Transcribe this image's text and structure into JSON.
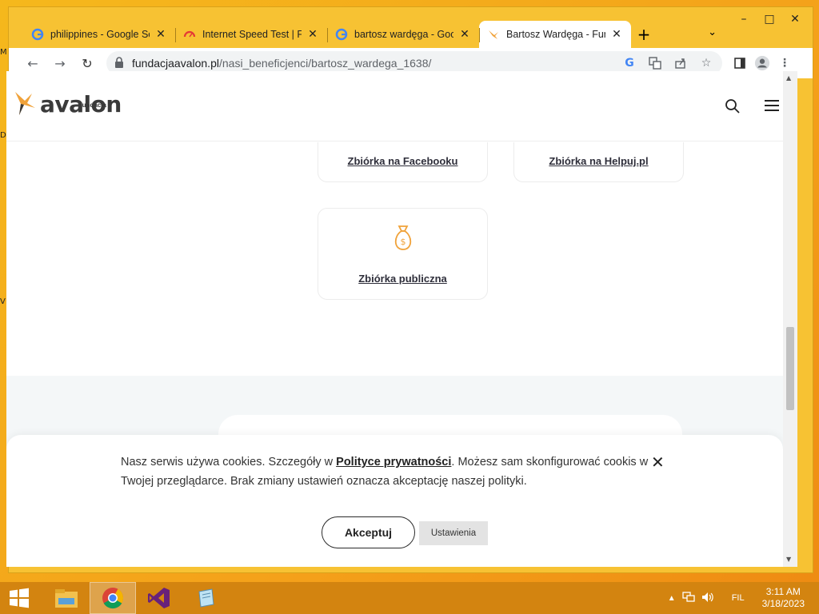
{
  "desktop": {
    "peek_letters": [
      "M",
      "D",
      "V"
    ]
  },
  "browser": {
    "tabs": [
      {
        "title": "philippines - Google Se",
        "favicon": "google-icon"
      },
      {
        "title": "Internet Speed Test | Fa",
        "favicon": "speedometer-icon"
      },
      {
        "title": "bartosz wardęga - Goo",
        "favicon": "google-icon"
      },
      {
        "title": "Bartosz Wardęga - Fund",
        "favicon": "avalon-bird-icon",
        "active": true
      }
    ],
    "url_host": "fundacjaavalon.pl",
    "url_path": "/nasi_beneficjenci/bartosz_wardega_1638/"
  },
  "site": {
    "logo_text": "avalon",
    "logo_small_text": "fundacja",
    "cards": [
      {
        "label": "Zbiórka na Facebooku"
      },
      {
        "label": "Zbiórka na Helpuj.pl"
      },
      {
        "label": "Zbiórka publiczna",
        "icon": "money-bag-icon"
      }
    ]
  },
  "cookie": {
    "text_before": "Nasz serwis używa cookies. Szczegóły w ",
    "link_text": "Polityce prywatności",
    "text_after": ". Możesz sam skonfigurować cookis w Twojej przeglądarce. Brak zmiany ustawień oznacza akceptację naszej polityki.",
    "accept_label": "Akceptuj",
    "settings_label": "Ustawienia"
  },
  "taskbar": {
    "language": "FIL",
    "time": "3:11 AM",
    "date": "3/18/2023"
  },
  "colors": {
    "accent_orange": "#f0a23a",
    "desktop": "#f4a11a",
    "taskbar": "#d38410"
  }
}
